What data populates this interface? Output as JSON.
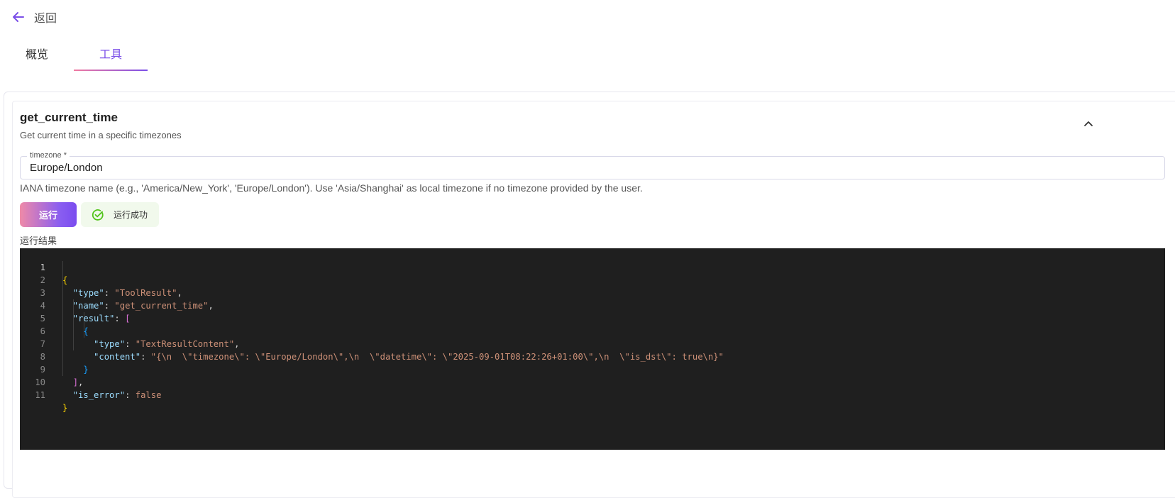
{
  "header": {
    "back_label": "返回"
  },
  "tabs": [
    {
      "label": "概览",
      "active": false
    },
    {
      "label": "工具",
      "active": true
    }
  ],
  "tool": {
    "name": "get_current_time",
    "description": "Get current time in a specific timezones",
    "field": {
      "label": "timezone *",
      "value": "Europe/London",
      "help": "IANA timezone name (e.g., 'America/New_York', 'Europe/London'). Use 'Asia/Shanghai' as local timezone if no timezone provided by the user."
    },
    "run_label": "运行",
    "status_label": "运行成功",
    "result_label": "运行结果"
  },
  "code": {
    "line_numbers": [
      "1",
      "2",
      "3",
      "4",
      "5",
      "6",
      "7",
      "8",
      "9",
      "10",
      "11"
    ],
    "k_type": "\"type\"",
    "v_toolresult": "\"ToolResult\"",
    "k_name": "\"name\"",
    "v_name": "\"get_current_time\"",
    "k_result": "\"result\"",
    "k_type2": "\"type\"",
    "v_textresult": "\"TextResultContent\"",
    "k_content": "\"content\"",
    "v_content": "\"{\\n  \\\"timezone\\\": \\\"Europe/London\\\",\\n  \\\"datetime\\\": \\\"2025-09-01T08:22:26+01:00\\\",\\n  \\\"is_dst\\\": true\\n}\"",
    "k_is_error": "\"is_error\"",
    "v_is_error": "false"
  },
  "colors": {
    "accent": "#7b4fe8",
    "code_bg": "#1f1f1f",
    "success": "#52c41a"
  }
}
